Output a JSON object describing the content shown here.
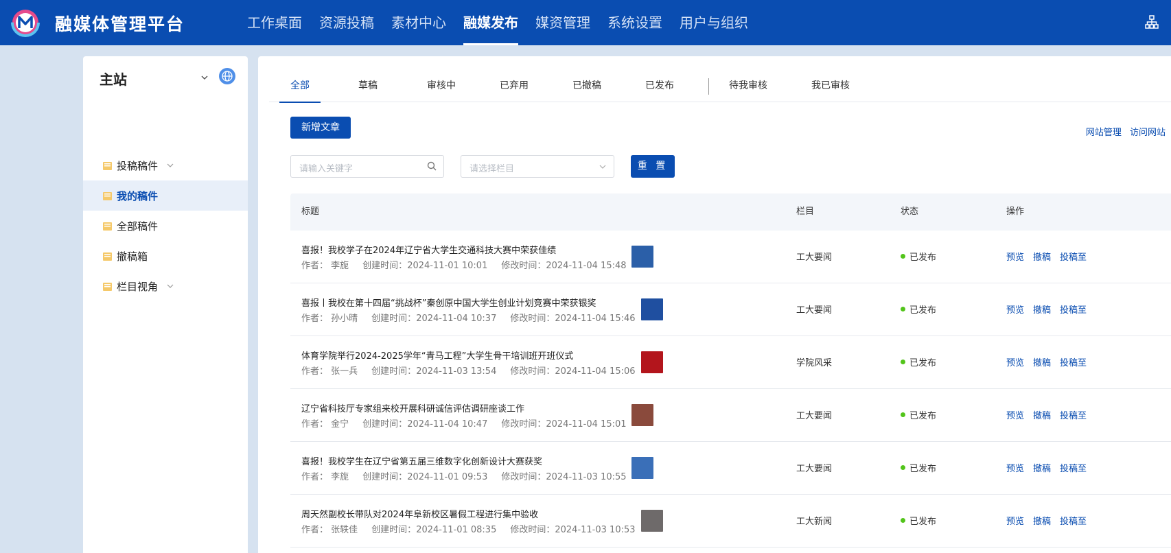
{
  "header": {
    "title": "融媒体管理平台",
    "nav": [
      "工作桌面",
      "资源投稿",
      "素材中心",
      "融媒发布",
      "媒资管理",
      "系统设置",
      "用户与组织"
    ],
    "active_nav": "融媒发布"
  },
  "sidebar": {
    "site": "主站",
    "items": [
      {
        "label": "投稿稿件",
        "has_chevron": true
      },
      {
        "label": "我的稿件",
        "active": true
      },
      {
        "label": "全部稿件"
      },
      {
        "label": "撤稿箱"
      },
      {
        "label": "栏目视角",
        "has_chevron": true
      }
    ]
  },
  "tabs": [
    "全部",
    "草稿",
    "审核中",
    "已弃用",
    "已撤稿",
    "已发布",
    "待我审核",
    "我已审核"
  ],
  "toolbar": {
    "new_article": "新增文章",
    "site_manage": "网站管理",
    "visit_site": "访问网站",
    "search_placeholder": "请输入关键字",
    "column_placeholder": "请选择栏目",
    "reset": "重 置"
  },
  "table": {
    "headers": [
      "标题",
      "栏目",
      "状态",
      "操作"
    ],
    "author_label": "作者：",
    "created_label": "创建时间：",
    "modified_label": "修改时间：",
    "actions": [
      "预览",
      "撤稿",
      "投稿至"
    ],
    "rows": [
      {
        "title": "喜报！我校学子在2024年辽宁省大学生交通科技大赛中荣获佳绩",
        "author": "李旎",
        "created": "2024-11-01 10:01",
        "modified": "2024-11-04 15:48",
        "column": "工大要闻",
        "status": "已发布",
        "thumb_color": "#2b5fa8"
      },
      {
        "title": "喜报丨我校在第十四届“挑战杯”秦创原中国大学生创业计划竞赛中荣获银奖",
        "author": "孙小晴",
        "created": "2024-11-04 10:37",
        "modified": "2024-11-04 15:46",
        "column": "工大要闻",
        "status": "已发布",
        "thumb_color": "#1f4fa0"
      },
      {
        "title": "体育学院举行2024-2025学年“青马工程”大学生骨干培训班开班仪式",
        "author": "张一兵",
        "created": "2024-11-03 13:54",
        "modified": "2024-11-04 15:06",
        "column": "学院风采",
        "status": "已发布",
        "thumb_color": "#b3151c"
      },
      {
        "title": "辽宁省科技厅专家组来校开展科研诚信评估调研座谈工作",
        "author": "金宁",
        "created": "2024-11-04 10:47",
        "modified": "2024-11-04 15:01",
        "column": "工大要闻",
        "status": "已发布",
        "thumb_color": "#8a4a3c"
      },
      {
        "title": "喜报！我校学生在辽宁省第五届三维数字化创新设计大赛获奖",
        "author": "李旎",
        "created": "2024-11-01 09:53",
        "modified": "2024-11-03 10:55",
        "column": "工大要闻",
        "status": "已发布",
        "thumb_color": "#3a6fb8"
      },
      {
        "title": "周天然副校长带队对2024年阜新校区暑假工程进行集中验收",
        "author": "张轶佳",
        "created": "2024-11-01 08:35",
        "modified": "2024-11-03 10:53",
        "column": "工大新闻",
        "status": "已发布",
        "thumb_color": "#6e6a6a"
      }
    ]
  }
}
